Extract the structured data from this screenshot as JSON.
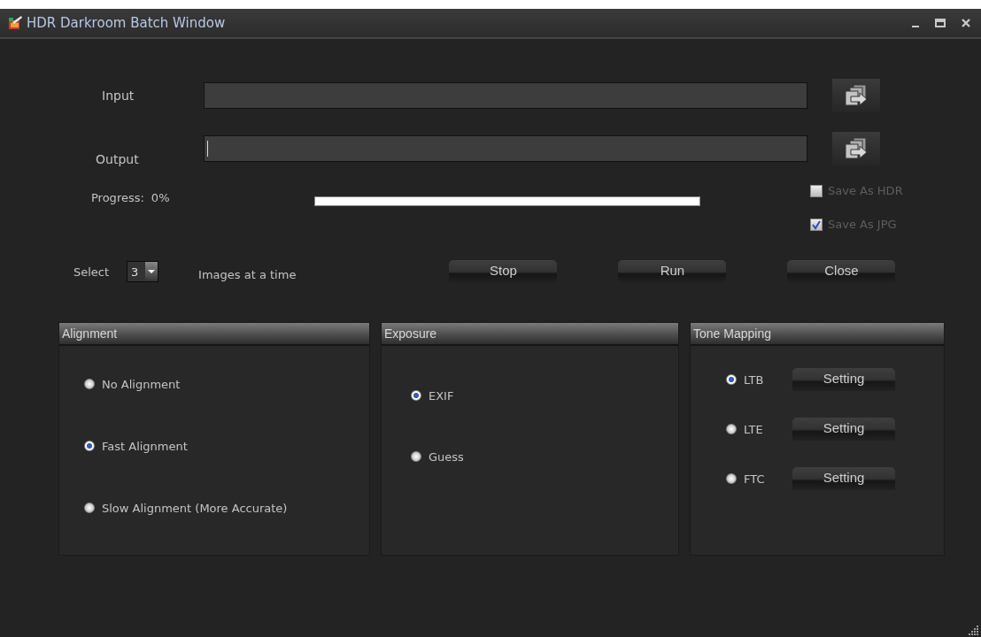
{
  "window": {
    "title": "HDR Darkroom Batch Window"
  },
  "paths": [
    {
      "label": "Input",
      "focused": false
    },
    {
      "label": "Output",
      "focused": true
    }
  ],
  "progress": {
    "label": "Progress:",
    "reading": "0%",
    "level": 0
  },
  "save_options": [
    {
      "label": "Save As HDR",
      "checked": false,
      "disabled": true
    },
    {
      "label": "Save As JPG",
      "checked": true,
      "disabled": true
    }
  ],
  "batch": {
    "prefix": "Select",
    "value": "3",
    "suffix": "Images at a time"
  },
  "buttons": [
    "Stop",
    "Run",
    "Close"
  ],
  "groups": [
    {
      "title": "Alignment",
      "kind": "plain",
      "options": [
        {
          "label": "No Alignment",
          "selected": false
        },
        {
          "label": "Fast Alignment",
          "selected": true
        },
        {
          "label": "Slow Alignment (More Accurate)",
          "selected": false
        }
      ]
    },
    {
      "title": "Exposure",
      "kind": "plain",
      "options": [
        {
          "label": "EXIF",
          "selected": true
        },
        {
          "label": "Guess",
          "selected": false
        }
      ]
    },
    {
      "title": "Tone Mapping",
      "kind": "setting",
      "options": [
        {
          "label": "LTB",
          "selected": true,
          "button": "Setting"
        },
        {
          "label": "LTE",
          "selected": false,
          "button": "Setting"
        },
        {
          "label": "FTC",
          "selected": false,
          "button": "Setting"
        }
      ]
    }
  ]
}
